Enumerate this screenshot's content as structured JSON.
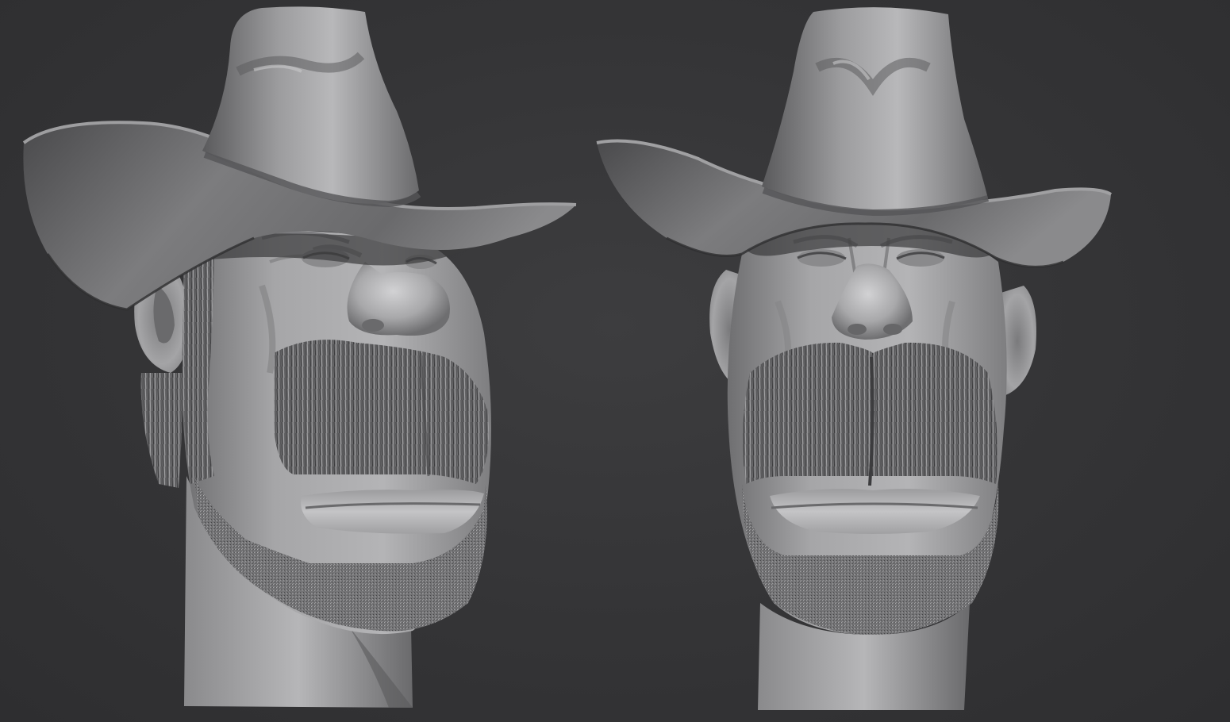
{
  "scene": {
    "background_color": "#363638",
    "clay_color": "#9a9a9c",
    "clay_shadow_color": "#3c3c3e",
    "clay_highlight_color": "#d8d8da",
    "hair_color": "#6e6e70",
    "views": [
      {
        "name": "three-quarter-view"
      },
      {
        "name": "front-view"
      }
    ]
  }
}
